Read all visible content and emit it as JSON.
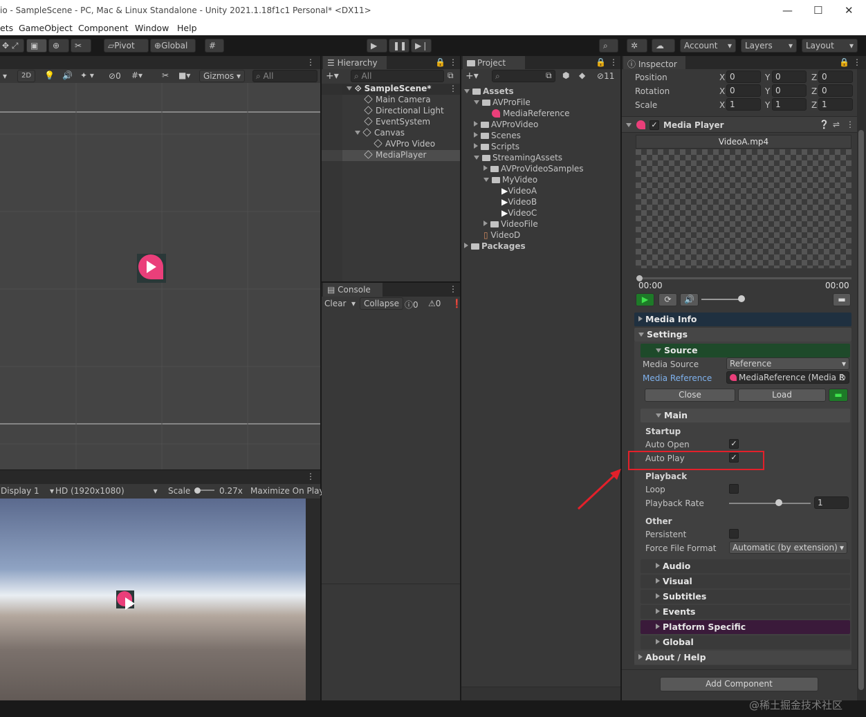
{
  "window": {
    "title": "io - SampleScene - PC, Mac & Linux Standalone - Unity 2021.1.18f1c1 Personal* <DX11>",
    "minimize": "—",
    "maximize": "☐",
    "close": "✕"
  },
  "menu": [
    "ets",
    "GameObject",
    "Component",
    "Window",
    "Help"
  ],
  "toolbar": {
    "pivot": "Pivot",
    "global": "Global",
    "account": "Account",
    "layers": "Layers",
    "layout": "Layout"
  },
  "scene": {
    "mode_2d": "2D",
    "hidden_count": "0",
    "gizmos": "Gizmos",
    "search_placeholder": "All"
  },
  "game": {
    "display": "Display 1",
    "resolution": "HD (1920x1080)",
    "scale_label": "Scale",
    "scale_value": "0.27x",
    "maximize": "Maximize On Play"
  },
  "hierarchy": {
    "tab": "Hierarchy",
    "search_placeholder": "All",
    "scene": "SampleScene*",
    "items": [
      "Main Camera",
      "Directional Light",
      "EventSystem",
      "Canvas",
      "AVPro Video",
      "MediaPlayer"
    ]
  },
  "console": {
    "tab": "Console",
    "clear": "Clear",
    "collapse": "Collapse",
    "info_count": "0",
    "warn_count": "0"
  },
  "project": {
    "tab": "Project",
    "hidden_count": "11",
    "items": [
      "Assets",
      "AVProFile",
      "MediaReference",
      "AVProVideo",
      "Scenes",
      "Scripts",
      "StreamingAssets",
      "AVProVideoSamples",
      "MyVideo",
      "VideoA",
      "VideoB",
      "VideoC",
      "VideoFile",
      "VideoD",
      "Packages"
    ]
  },
  "inspector": {
    "tab": "Inspector",
    "transform": {
      "position": {
        "label": "Position",
        "x": "0",
        "y": "0",
        "z": "0"
      },
      "rotation": {
        "label": "Rotation",
        "x": "0",
        "y": "0",
        "z": "0"
      },
      "scale": {
        "label": "Scale",
        "x": "1",
        "y": "1",
        "z": "1"
      },
      "x": "X",
      "y": "Y",
      "z": "Z"
    },
    "component": "Media Player",
    "preview_file": "VideoA.mp4",
    "time_start": "00:00",
    "time_end": "00:00",
    "sections": {
      "media_info": "Media Info",
      "settings": "Settings",
      "source": "Source",
      "main": "Main",
      "audio": "Audio",
      "visual": "Visual",
      "subtitles": "Subtitles",
      "events": "Events",
      "platform_specific": "Platform Specific",
      "global": "Global",
      "about": "About / Help"
    },
    "source": {
      "media_source_label": "Media Source",
      "media_source_value": "Reference",
      "media_reference_label": "Media Reference",
      "media_reference_value": "MediaReference (Media R",
      "close": "Close",
      "load": "Load"
    },
    "main": {
      "startup": "Startup",
      "auto_open": "Auto Open",
      "auto_play": "Auto Play",
      "playback": "Playback",
      "loop": "Loop",
      "playback_rate": "Playback Rate",
      "playback_rate_value": "1",
      "other": "Other",
      "persistent": "Persistent",
      "force_file_format": "Force File Format",
      "force_file_format_value": "Automatic (by extension)"
    },
    "add_component": "Add Component"
  },
  "watermark": "@稀土掘金技术社区",
  "colors": {
    "highlight": "#e3202a",
    "source_header": "#1e4a2a",
    "platform_header": "#3a1a3a",
    "info_header": "#1f3040"
  }
}
